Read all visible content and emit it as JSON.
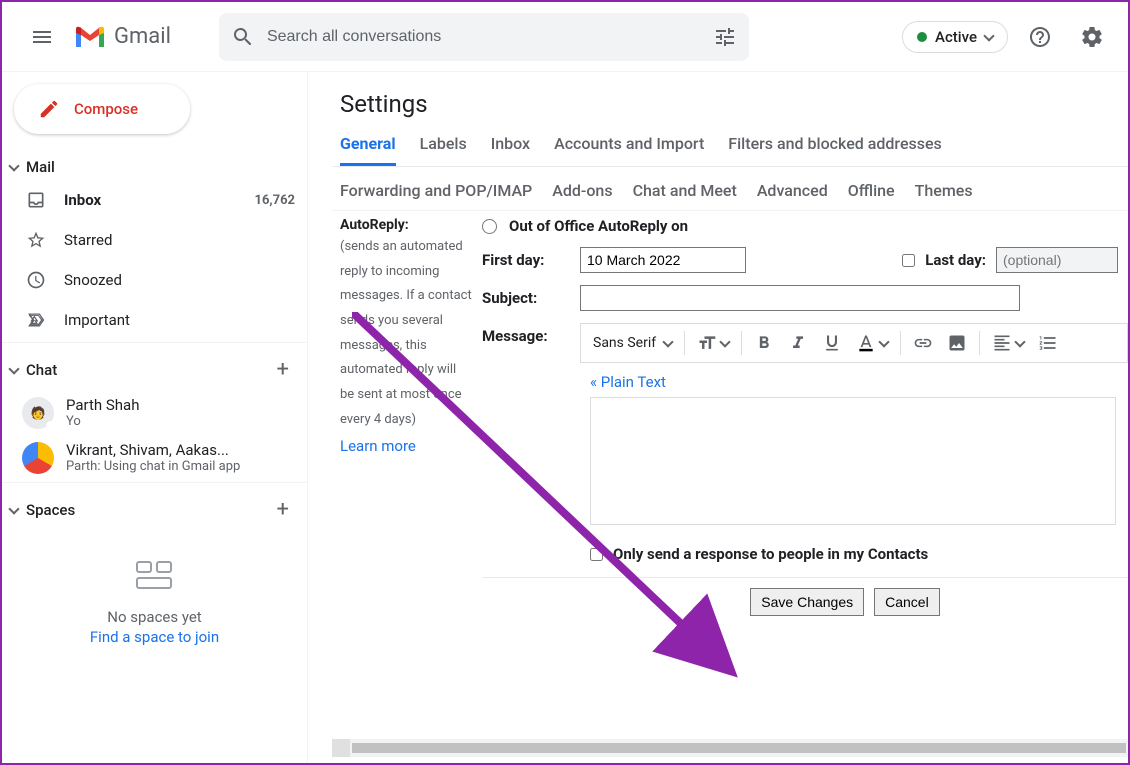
{
  "header": {
    "product_name": "Gmail",
    "search": {
      "placeholder": "Search all conversations"
    },
    "status_label": "Active"
  },
  "sidebar": {
    "compose_label": "Compose",
    "mail_section": "Mail",
    "nav": {
      "inbox": {
        "label": "Inbox",
        "count": "16,762"
      },
      "starred": {
        "label": "Starred"
      },
      "snoozed": {
        "label": "Snoozed"
      },
      "important": {
        "label": "Important"
      }
    },
    "chat_section": "Chat",
    "chats": [
      {
        "name": "Parth Shah",
        "sub": "Yo"
      },
      {
        "name": "Vikrant, Shivam, Aakas...",
        "sub": "Parth: Using chat in Gmail app"
      }
    ],
    "spaces_section": "Spaces",
    "spaces_empty": {
      "msg": "No spaces yet",
      "link": "Find a space to join"
    }
  },
  "settings": {
    "page_title": "Settings",
    "tabs1": [
      "General",
      "Labels",
      "Inbox",
      "Accounts and Import",
      "Filters and blocked addresses"
    ],
    "tabs2": [
      "Forwarding and POP/IMAP",
      "Add-ons",
      "Chat and Meet",
      "Advanced",
      "Offline",
      "Themes"
    ],
    "autoreply": {
      "title": "AutoReply:",
      "desc": "(sends an automated reply to incoming messages. If a contact sends you several messages, this automated reply will be sent at most once every 4 days)",
      "learn_more": "Learn more",
      "radio_label": "Out of Office AutoReply on",
      "first_day_label": "First day:",
      "first_day_value": "10 March 2022",
      "last_day_label": "Last day:",
      "last_day_placeholder": "(optional)",
      "subject_label": "Subject:",
      "message_label": "Message:",
      "font_label": "Sans Serif",
      "plain_text": "« Plain Text",
      "only_contacts": "Only send a response to people in my Contacts",
      "save_label": "Save Changes",
      "cancel_label": "Cancel"
    }
  }
}
